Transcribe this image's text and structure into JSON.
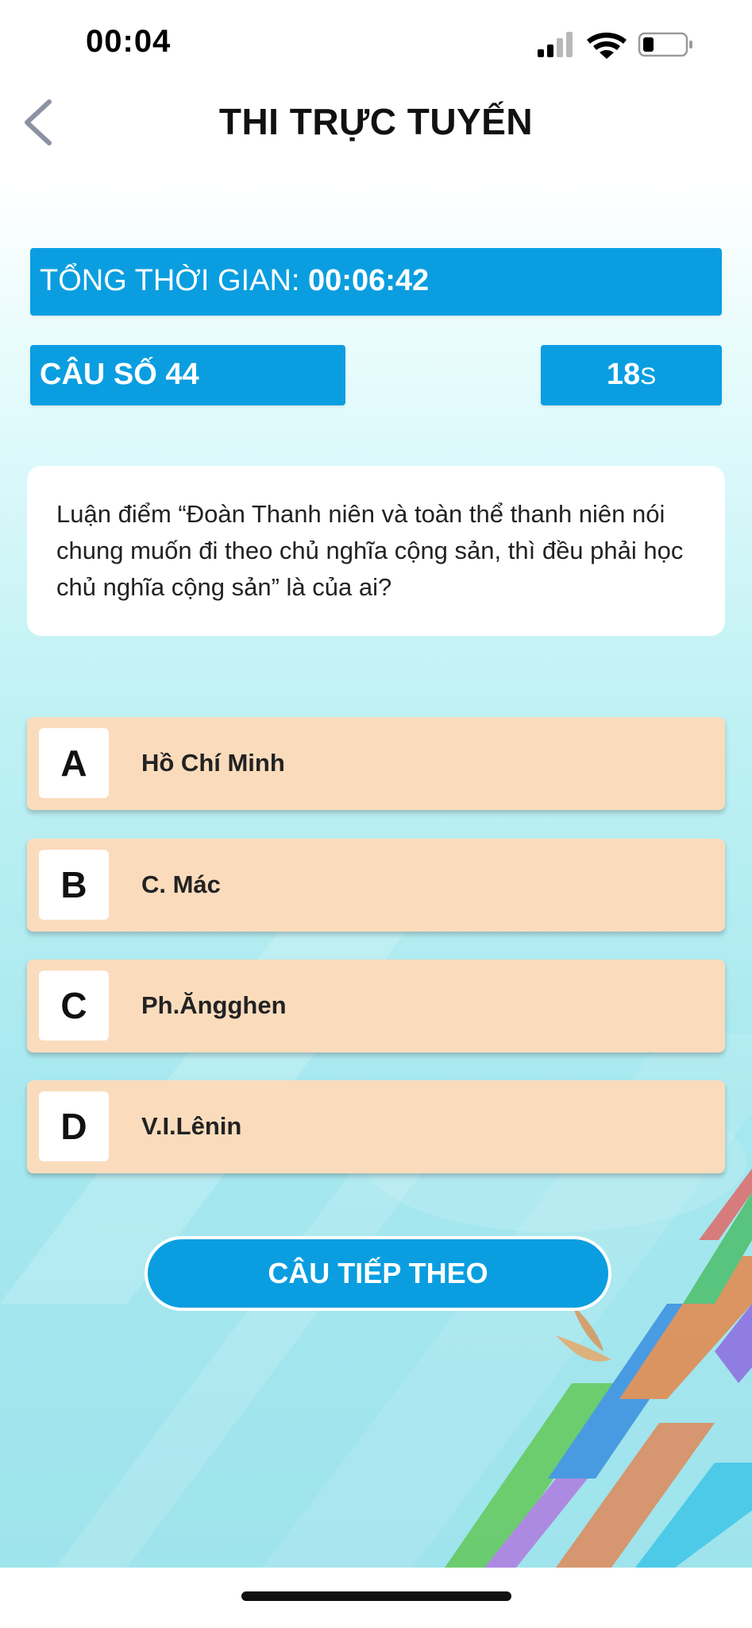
{
  "status_bar": {
    "time": "00:04"
  },
  "header": {
    "title": "THI TRỰC TUYẾN",
    "back_icon": "chevron-left-icon"
  },
  "total_time": {
    "label": "TỔNG THỜI GIAN: ",
    "value": "00:06:42"
  },
  "question_number": "CÂU SỐ 44",
  "countdown": {
    "value": "18",
    "unit": "S"
  },
  "question": {
    "text": "Luận điểm “Đoàn Thanh niên và toàn thể thanh niên nói chung muốn đi theo chủ nghĩa cộng sản, thì đều phải học chủ nghĩa cộng sản” là của ai?"
  },
  "answers": [
    {
      "letter": "A",
      "text": "Hồ Chí Minh"
    },
    {
      "letter": "B",
      "text": "C. Mác"
    },
    {
      "letter": "C",
      "text": "Ph.Ăngghen"
    },
    {
      "letter": "D",
      "text": "V.I.Lênin"
    }
  ],
  "next_button": {
    "label": "CÂU TIẾP THEO"
  },
  "colors": {
    "primary_blue": "#0a9ee0",
    "answer_bg": "#fadcbd",
    "background_cyan": "#a6e8ef"
  }
}
